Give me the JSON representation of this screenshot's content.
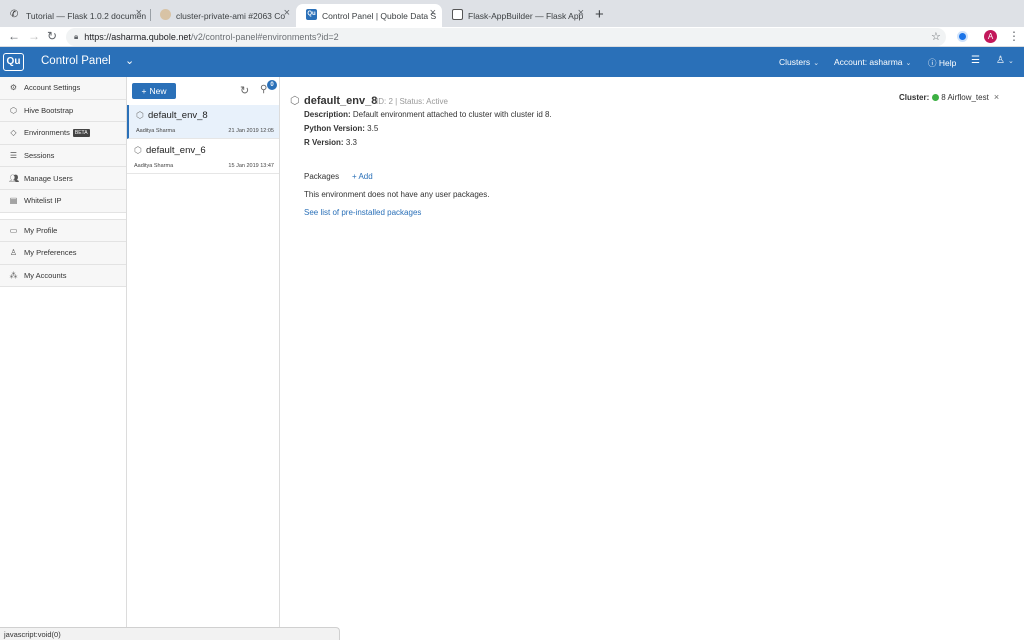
{
  "browser": {
    "tabs": [
      {
        "title": "Tutorial — Flask 1.0.2 documen",
        "active": false
      },
      {
        "title": "cluster-private-ami #2063 Co",
        "active": false
      },
      {
        "title": "Control Panel  | Qubole Data S",
        "active": true
      },
      {
        "title": "Flask-AppBuilder — Flask App",
        "active": false
      }
    ],
    "url_host": "https://asharma.qubole.net",
    "url_path": "/v2/control-panel#environments?id=2",
    "profile_initial": "A"
  },
  "header": {
    "logo": "Qu",
    "title": "Control Panel",
    "clusters_label": "Clusters",
    "account_label": "Account: asharma",
    "help_label": "Help"
  },
  "sidebar": {
    "items": [
      {
        "label": "Account Settings"
      },
      {
        "label": "Hive Bootstrap"
      },
      {
        "label": "Environments",
        "badge": "BETA"
      },
      {
        "label": "Sessions"
      },
      {
        "label": "Manage Users"
      },
      {
        "label": "Whitelist IP"
      }
    ],
    "items2": [
      {
        "label": "My Profile"
      },
      {
        "label": "My Preferences"
      },
      {
        "label": "My Accounts"
      }
    ]
  },
  "envlist": {
    "new_label": "New",
    "badge_count": "0",
    "items": [
      {
        "name": "default_env_8",
        "author": "Aaditya Sharma",
        "date": "21 Jan 2019 12:05"
      },
      {
        "name": "default_env_6",
        "author": "Aaditya Sharma",
        "date": "15 Jan 2019 13:47"
      }
    ]
  },
  "detail": {
    "title": "default_env_8",
    "id_text": "ID: 2",
    "status_text": "Status: Active",
    "description_label": "Description:",
    "description": "Default environment attached to cluster with cluster id 8.",
    "python_label": "Python Version:",
    "python": "3.5",
    "r_label": "R Version:",
    "r": "3.3",
    "packages_label": "Packages",
    "add_label": "+ Add",
    "no_packages": "This environment does not have any user packages.",
    "preinstalled_link": "See list of pre-installed packages",
    "cluster_label": "Cluster:",
    "cluster_value": "8 Airflow_test"
  },
  "status_bar": "javascript:void(0)",
  "colors": {
    "brand": "#2a70b8",
    "status_green": "#3cb043"
  }
}
